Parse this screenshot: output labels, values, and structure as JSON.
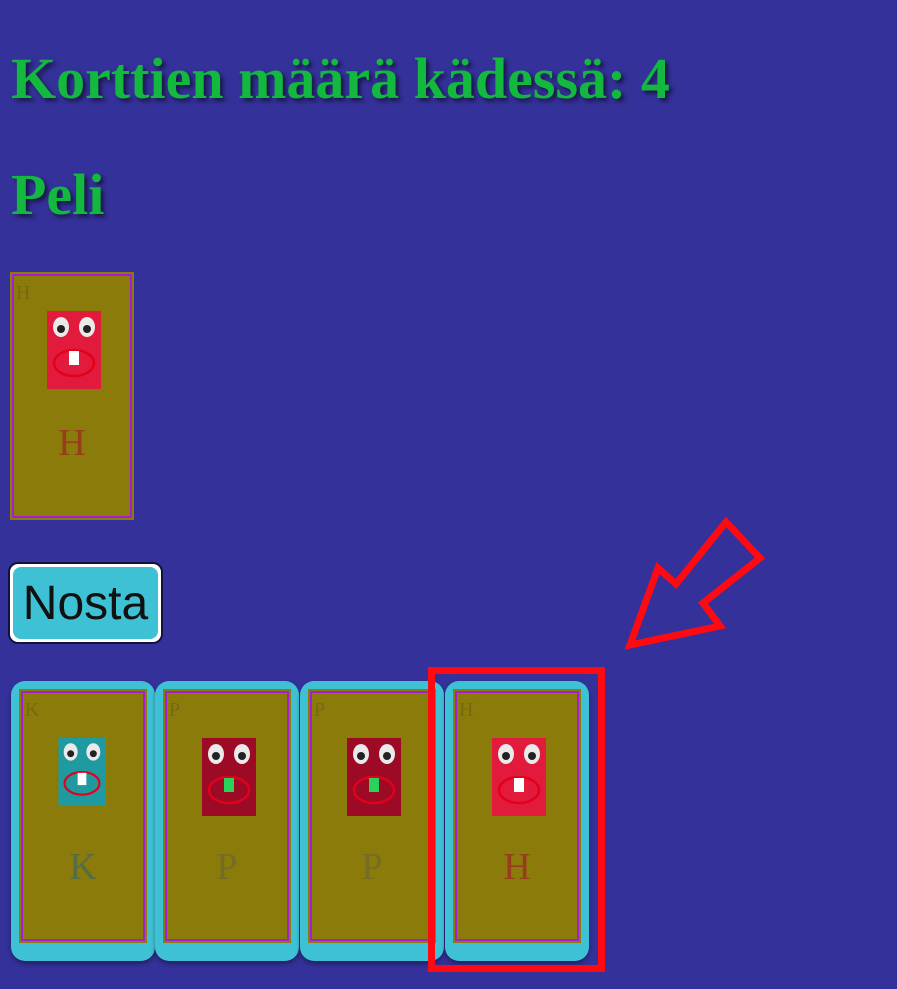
{
  "header": {
    "card_count_text": "Korttien määrä kädessä: 4"
  },
  "game": {
    "title": "Peli",
    "pile_card": {
      "letter": "H",
      "face_color": "#e21a3c",
      "tooth_color": "#ffffff",
      "letter_color": "#9c2e20"
    },
    "draw_button_label": "Nosta"
  },
  "hand": {
    "cards": [
      {
        "letter": "K",
        "face_color": "#1f9aa0",
        "tooth_color": "#ffffff",
        "letter_color": "#486a52"
      },
      {
        "letter": "P",
        "face_color": "#9c0a26",
        "tooth_color": "#27d35a",
        "letter_color": "#6f6a2e"
      },
      {
        "letter": "P",
        "face_color": "#9c0a26",
        "tooth_color": "#27d35a",
        "letter_color": "#6f6a2e"
      },
      {
        "letter": "H",
        "face_color": "#e21a3c",
        "tooth_color": "#ffffff",
        "letter_color": "#9c2e20"
      }
    ],
    "highlighted_index": 3
  },
  "colors": {
    "background": "#34319a",
    "heading": "#13b83e",
    "card": "#8a7b0a",
    "card_border": "#a41ed6",
    "hand_slot": "#3fc1d5",
    "highlight": "#ff0a12"
  },
  "icons": {
    "pointer": "arrow-icon",
    "face": "monster-face-icon"
  }
}
